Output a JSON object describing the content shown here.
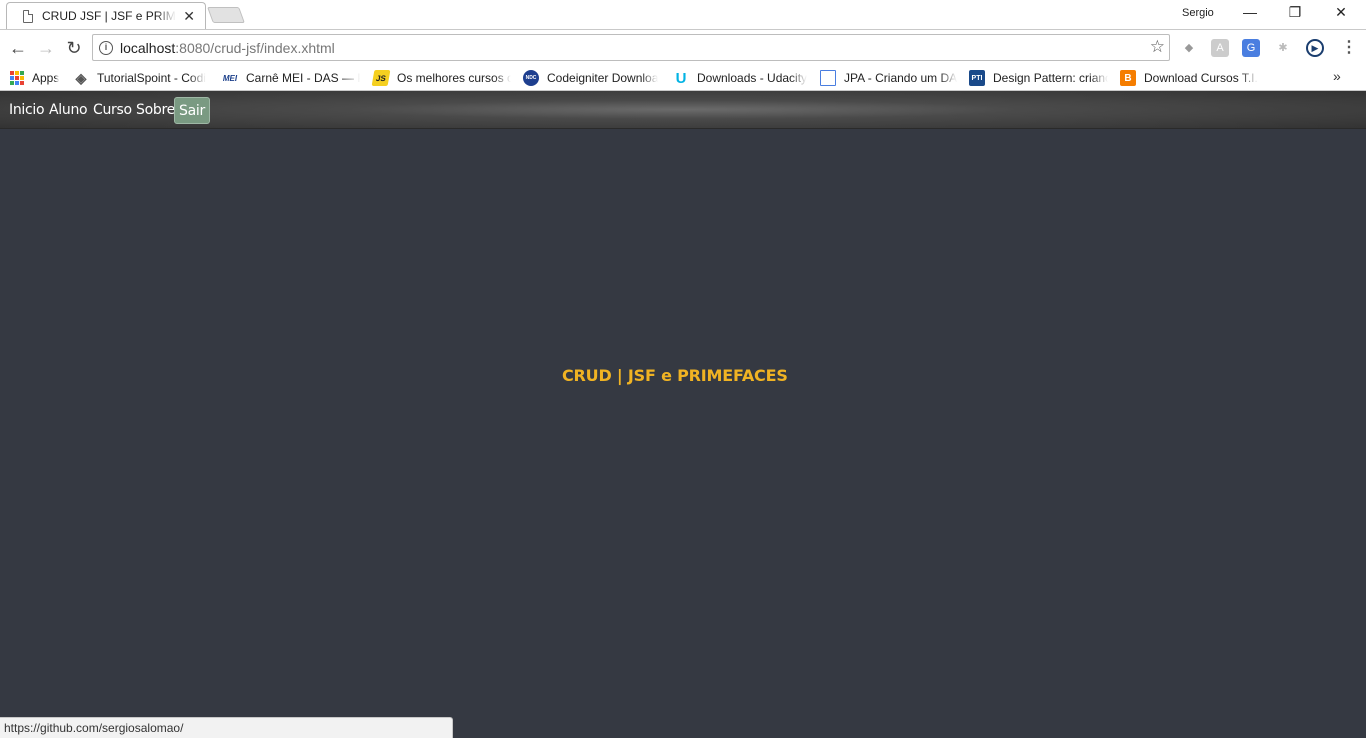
{
  "browser": {
    "tab_title": "CRUD JSF | JSF e PRIMEFACES",
    "tab_close": "✕",
    "profile_name": "Sergio",
    "window_controls": {
      "minimize": "—",
      "restore": "❐",
      "close": "✕"
    },
    "nav": {
      "back": "←",
      "forward": "→",
      "reload": "↻"
    },
    "url_host": "localhost",
    "url_rest": ":8080/crud-jsf/index.xhtml",
    "star": "☆",
    "menu": "⋮",
    "bookmarks_more": "»",
    "bookmarks": [
      {
        "label": "Apps",
        "icon": "apps-grid-icon"
      },
      {
        "label": "TutorialSpoint - Codi",
        "icon": "tutorialspoint-icon"
      },
      {
        "label": "Carnê MEI - DAS — P",
        "icon": "mei-icon",
        "icon_text": "MEI"
      },
      {
        "label": "Os melhores cursos o",
        "icon": "js-icon",
        "icon_text": "JS"
      },
      {
        "label": "Codeigniter Downloa",
        "icon": "codeigniter-icon",
        "icon_text": "NDC"
      },
      {
        "label": "Downloads - Udacity",
        "icon": "udacity-icon",
        "icon_text": "U"
      },
      {
        "label": "JPA - Criando um DAO",
        "icon": "jpa-icon",
        "icon_text": ""
      },
      {
        "label": "Design Pattern: crianc",
        "icon": "pti-icon",
        "icon_text": "PTI"
      },
      {
        "label": "Download Cursos T.I.",
        "icon": "blogger-icon",
        "icon_text": "B"
      }
    ]
  },
  "app": {
    "menu": [
      {
        "label": "Inicio",
        "active": false
      },
      {
        "label": "Aluno",
        "active": false
      },
      {
        "label": "Curso",
        "active": false
      },
      {
        "label": "Sobre",
        "active": false
      },
      {
        "label": "Sair",
        "active": true
      }
    ],
    "headline": "CRUD | JSF e PRIMEFACES"
  },
  "status_url": "https://github.com/sergiosalomao/",
  "colors": {
    "background": "#353942",
    "headline": "#f0b323",
    "active_menu": "#7a9a82"
  }
}
